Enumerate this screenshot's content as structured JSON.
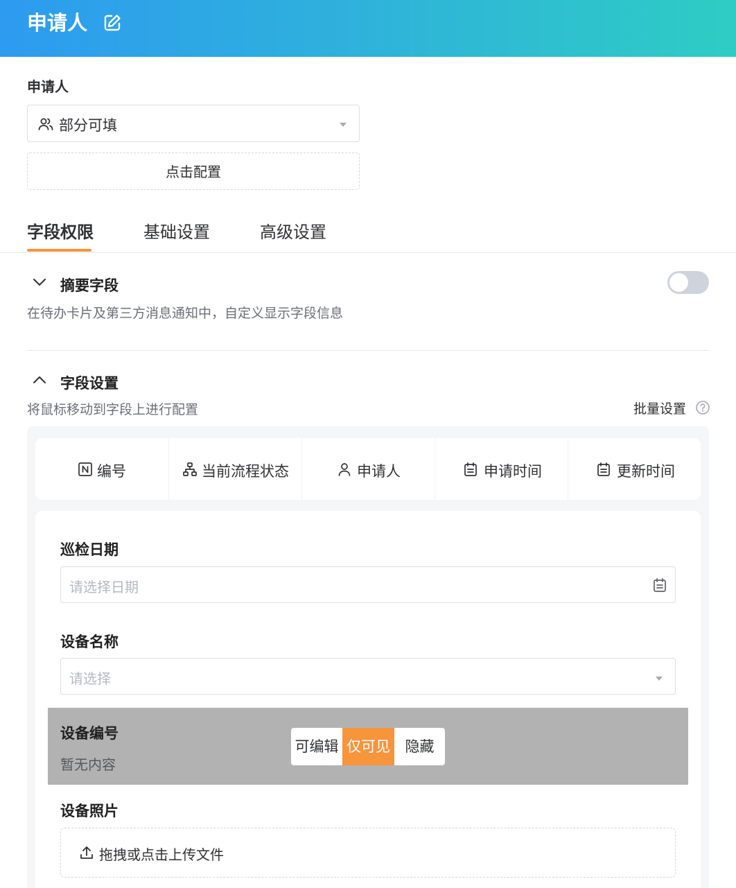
{
  "header": {
    "title": "申请人",
    "edit_icon": "edit-icon"
  },
  "applicant": {
    "label": "申请人",
    "select_value": "部分可填",
    "select_icon": "users-icon",
    "config_button": "点击配置"
  },
  "tabs": [
    {
      "label": "字段权限",
      "active": true
    },
    {
      "label": "基础设置",
      "active": false
    },
    {
      "label": "高级设置",
      "active": false
    }
  ],
  "summary": {
    "title": "摘要字段",
    "description": "在待办卡片及第三方消息通知中，自定义显示字段信息",
    "toggle_on": false,
    "expanded": false
  },
  "field_settings": {
    "title": "字段设置",
    "description": "将鼠标移动到字段上进行配置",
    "batch_label": "批量设置",
    "expanded": true
  },
  "system_fields": [
    {
      "label": "编号",
      "icon": "number-icon"
    },
    {
      "label": "当前流程状态",
      "icon": "flow-icon"
    },
    {
      "label": "申请人",
      "icon": "user-icon"
    },
    {
      "label": "申请时间",
      "icon": "calendar-icon"
    },
    {
      "label": "更新时间",
      "icon": "calendar-icon"
    }
  ],
  "form": {
    "inspection_date": {
      "label": "巡检日期",
      "placeholder": "请选择日期"
    },
    "device_name": {
      "label": "设备名称",
      "placeholder": "请选择"
    },
    "device_number": {
      "label": "设备编号",
      "empty_text": "暂无内容",
      "permission_options": [
        "可编辑",
        "仅可见",
        "隐藏"
      ],
      "selected": "仅可见"
    },
    "device_photo": {
      "label": "设备照片",
      "upload_text": "拖拽或点击上传文件"
    }
  },
  "colors": {
    "accent": "#f7943c",
    "header_start": "#2d9bf0",
    "header_end": "#2ecdc4"
  }
}
